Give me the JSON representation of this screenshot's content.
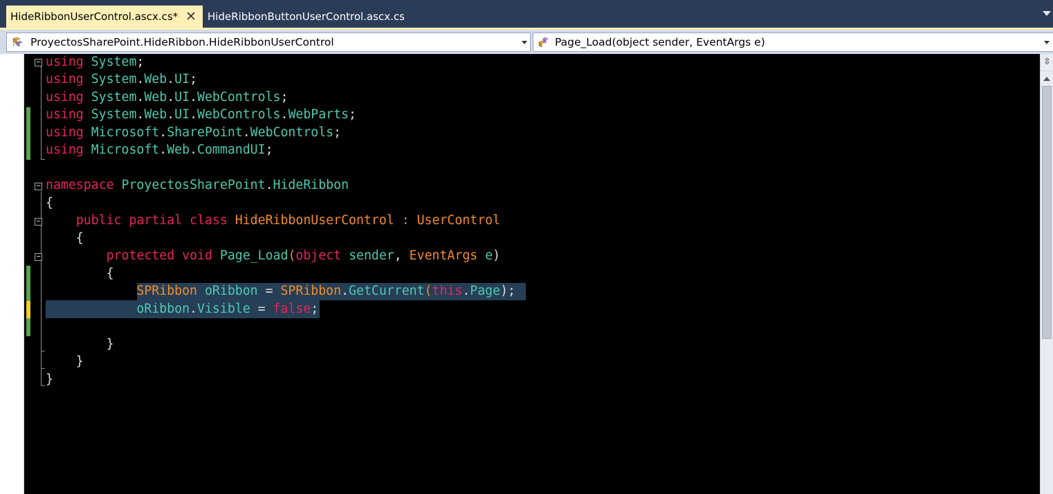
{
  "tabs": [
    {
      "label": "HideRibbonUserControl.ascx.cs*",
      "active": true,
      "close_glyph": "✕"
    },
    {
      "label": "HideRibbonButtonUserControl.ascx.cs",
      "active": false
    }
  ],
  "navigation": {
    "type_selector": {
      "value": "ProyectosSharePoint.HideRibbon.HideRibbonUserControl",
      "icon": "class-icon"
    },
    "member_selector": {
      "value": "Page_Load(object sender, EventArgs e)",
      "icon": "method-icon"
    }
  },
  "colors": {
    "keyword": "#e8245a",
    "namespace_identifier": "#4ec9b0",
    "type": "#f38b2a",
    "plain_text": "#dcdcdc",
    "editor_background": "#000000",
    "selection": "#263f56",
    "change_saved": "#57a64a",
    "change_unsaved": "#efd21d",
    "active_tab": "#fdf0b7"
  },
  "code": {
    "lines": [
      [
        {
          "t": "kw",
          "v": "using"
        },
        {
          "t": "pu",
          "v": " "
        },
        {
          "t": "ns",
          "v": "System"
        },
        {
          "t": "pu",
          "v": ";"
        }
      ],
      [
        {
          "t": "kw",
          "v": "using"
        },
        {
          "t": "pu",
          "v": " "
        },
        {
          "t": "ns",
          "v": "System"
        },
        {
          "t": "pu",
          "v": "."
        },
        {
          "t": "ns",
          "v": "Web"
        },
        {
          "t": "pu",
          "v": "."
        },
        {
          "t": "ns",
          "v": "UI"
        },
        {
          "t": "pu",
          "v": ";"
        }
      ],
      [
        {
          "t": "kw",
          "v": "using"
        },
        {
          "t": "pu",
          "v": " "
        },
        {
          "t": "ns",
          "v": "System"
        },
        {
          "t": "pu",
          "v": "."
        },
        {
          "t": "ns",
          "v": "Web"
        },
        {
          "t": "pu",
          "v": "."
        },
        {
          "t": "ns",
          "v": "UI"
        },
        {
          "t": "pu",
          "v": "."
        },
        {
          "t": "ns",
          "v": "WebControls"
        },
        {
          "t": "pu",
          "v": ";"
        }
      ],
      [
        {
          "t": "kw",
          "v": "using"
        },
        {
          "t": "pu",
          "v": " "
        },
        {
          "t": "ns",
          "v": "System"
        },
        {
          "t": "pu",
          "v": "."
        },
        {
          "t": "ns",
          "v": "Web"
        },
        {
          "t": "pu",
          "v": "."
        },
        {
          "t": "ns",
          "v": "UI"
        },
        {
          "t": "pu",
          "v": "."
        },
        {
          "t": "ns",
          "v": "WebControls"
        },
        {
          "t": "pu",
          "v": "."
        },
        {
          "t": "ns",
          "v": "WebParts"
        },
        {
          "t": "pu",
          "v": ";"
        }
      ],
      [
        {
          "t": "kw",
          "v": "using"
        },
        {
          "t": "pu",
          "v": " "
        },
        {
          "t": "ns",
          "v": "Microsoft"
        },
        {
          "t": "pu",
          "v": "."
        },
        {
          "t": "ns",
          "v": "SharePoint"
        },
        {
          "t": "pu",
          "v": "."
        },
        {
          "t": "ns",
          "v": "WebControls"
        },
        {
          "t": "pu",
          "v": ";"
        }
      ],
      [
        {
          "t": "kw",
          "v": "using"
        },
        {
          "t": "pu",
          "v": " "
        },
        {
          "t": "ns",
          "v": "Microsoft"
        },
        {
          "t": "pu",
          "v": "."
        },
        {
          "t": "ns",
          "v": "Web"
        },
        {
          "t": "pu",
          "v": "."
        },
        {
          "t": "ns",
          "v": "CommandUI"
        },
        {
          "t": "pu",
          "v": ";"
        }
      ],
      [],
      [
        {
          "t": "kw",
          "v": "namespace"
        },
        {
          "t": "pu",
          "v": " "
        },
        {
          "t": "ns",
          "v": "ProyectosSharePoint"
        },
        {
          "t": "pu",
          "v": "."
        },
        {
          "t": "ns",
          "v": "HideRibbon"
        }
      ],
      [
        {
          "t": "pu",
          "v": "{"
        }
      ],
      [
        {
          "t": "pu",
          "v": "    "
        },
        {
          "t": "kw",
          "v": "public"
        },
        {
          "t": "pu",
          "v": " "
        },
        {
          "t": "kw",
          "v": "partial"
        },
        {
          "t": "pu",
          "v": " "
        },
        {
          "t": "kw",
          "v": "class"
        },
        {
          "t": "pu",
          "v": " "
        },
        {
          "t": "ty",
          "v": "HideRibbonUserControl"
        },
        {
          "t": "pu",
          "v": " "
        },
        {
          "t": "ty",
          "v": ":"
        },
        {
          "t": "pu",
          "v": " "
        },
        {
          "t": "ty",
          "v": "UserControl"
        }
      ],
      [
        {
          "t": "pu",
          "v": "    {"
        }
      ],
      [
        {
          "t": "pu",
          "v": "        "
        },
        {
          "t": "kw",
          "v": "protected"
        },
        {
          "t": "pu",
          "v": " "
        },
        {
          "t": "kw",
          "v": "void"
        },
        {
          "t": "pu",
          "v": " "
        },
        {
          "t": "me",
          "v": "Page_Load"
        },
        {
          "t": "ty",
          "v": "("
        },
        {
          "t": "kw",
          "v": "object"
        },
        {
          "t": "pu",
          "v": " "
        },
        {
          "t": "ns",
          "v": "sender"
        },
        {
          "t": "pu",
          "v": ", "
        },
        {
          "t": "ty",
          "v": "EventArgs"
        },
        {
          "t": "pu",
          "v": " "
        },
        {
          "t": "ns",
          "v": "e"
        },
        {
          "t": "pu",
          "v": ")"
        }
      ],
      [
        {
          "t": "pu",
          "v": "        {"
        }
      ],
      [
        {
          "t": "pu",
          "v": "            "
        },
        {
          "t": "ty",
          "v": "SPRibbon"
        },
        {
          "t": "pu",
          "v": " "
        },
        {
          "t": "ns",
          "v": "oRibbon"
        },
        {
          "t": "pu",
          "v": " = "
        },
        {
          "t": "ty",
          "v": "SPRibbon"
        },
        {
          "t": "pu",
          "v": "."
        },
        {
          "t": "me",
          "v": "GetCurrent"
        },
        {
          "t": "ty",
          "v": "("
        },
        {
          "t": "kw",
          "v": "this"
        },
        {
          "t": "pu",
          "v": "."
        },
        {
          "t": "ns",
          "v": "Page"
        },
        {
          "t": "pu",
          "v": ");"
        }
      ],
      [
        {
          "t": "pu",
          "v": "            "
        },
        {
          "t": "ns",
          "v": "oRibbon"
        },
        {
          "t": "pu",
          "v": "."
        },
        {
          "t": "ns",
          "v": "Visible"
        },
        {
          "t": "pu",
          "v": " = "
        },
        {
          "t": "kw",
          "v": "false"
        },
        {
          "t": "pu",
          "v": ";"
        }
      ],
      [],
      [
        {
          "t": "pu",
          "v": "        }"
        }
      ],
      [
        {
          "t": "pu",
          "v": "    }"
        }
      ],
      [
        {
          "t": "pu",
          "v": "}"
        }
      ]
    ]
  },
  "scrollbar": {
    "split_glyph": "⇳"
  }
}
